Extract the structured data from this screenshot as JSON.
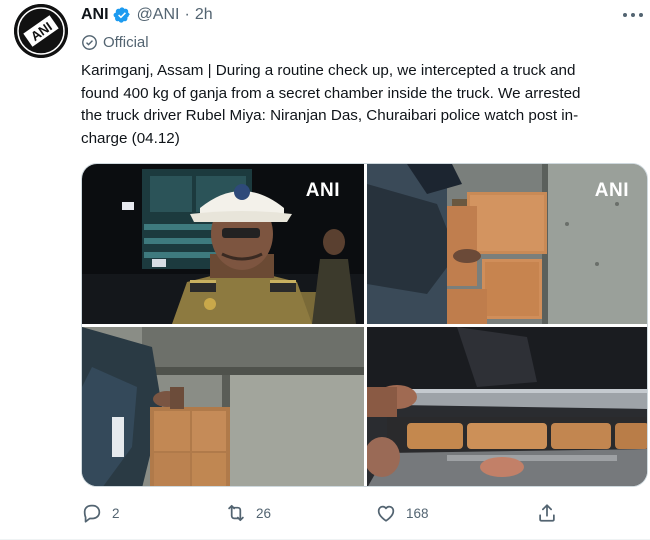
{
  "tweet": {
    "author": {
      "name": "ANI",
      "handle": "@ANI",
      "separator": "·",
      "time": "2h",
      "avatar_text": "ANI",
      "verified_icon": "verified-badge-icon"
    },
    "official_label": "Official",
    "text_lines": [
      "Karimganj, Assam | During a routine check up, we intercepted a truck and",
      "found 400 kg of ganja from a secret chamber inside the truck. We arrested",
      "the truck driver Rubel Miya: Niranjan Das, Churaibari police watch post in-",
      "charge (04.12)"
    ],
    "media": {
      "watermark": "ANI",
      "photos": [
        "police-officer-photo",
        "ganja-packets-photo",
        "secret-chamber-photo",
        "chamber-packets-photo"
      ]
    },
    "actions": {
      "reply_count": "2",
      "retweet_count": "26",
      "like_count": "168",
      "share_label": ""
    },
    "colors": {
      "text": "#0f1419",
      "secondary": "#536471",
      "verified": "#1d9bf0",
      "border": "#cfd9de"
    }
  }
}
